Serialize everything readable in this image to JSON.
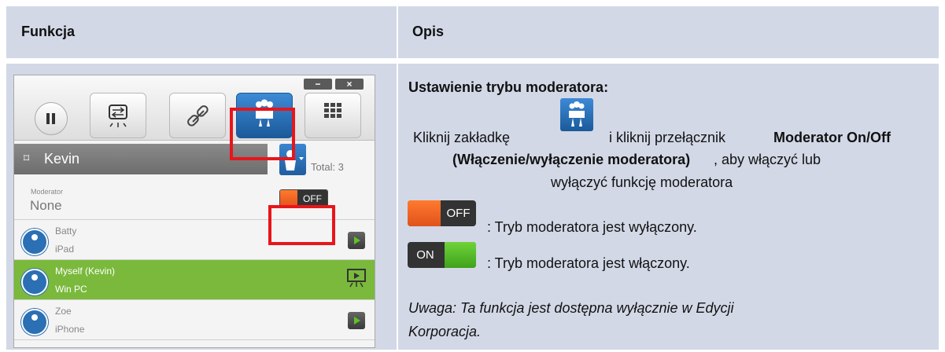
{
  "table": {
    "header_function": "Funkcja",
    "header_description": "Opis"
  },
  "app": {
    "window_minimize": "−",
    "window_close": "×",
    "user_name": "Kevin",
    "total_label": "Total: 3",
    "moderator_label": "Moderator",
    "moderator_value": "None",
    "toggle_state": "OFF",
    "participants": [
      {
        "name": "Batty",
        "device": "iPad",
        "active": false
      },
      {
        "name": "Myself (Kevin)",
        "device": "Win PC",
        "active": true
      },
      {
        "name": "Zoe",
        "device": "iPhone",
        "active": false
      }
    ]
  },
  "description": {
    "heading": "Ustawienie trybu moderatora:",
    "line1_a": "Kliknij zakładkę",
    "line1_b": "i kliknij przełącznik",
    "line1_bold": "Moderator On/Off",
    "line2_bold": "(Włączenie/wyłączenie moderatora)",
    "line2_rest": ", aby włączyć lub",
    "line3": "wyłączyć funkcję moderatora",
    "off_label": "OFF",
    "off_text": ": Tryb moderatora jest wyłączony.",
    "on_label": "ON",
    "on_text": ": Tryb moderatora jest włączony.",
    "note_line1": "Uwaga: Ta funkcja jest dostępna wyłącznie w Edycji",
    "note_line2": "Korporacja."
  },
  "colors": {
    "table_bg": "#d2d8e6",
    "highlight_red": "#e8151b",
    "active_row_green": "#7ab93c",
    "toggle_orange": "#f26a21",
    "toggle_green": "#5ec12a",
    "accent_blue": "#2b6fb4"
  }
}
